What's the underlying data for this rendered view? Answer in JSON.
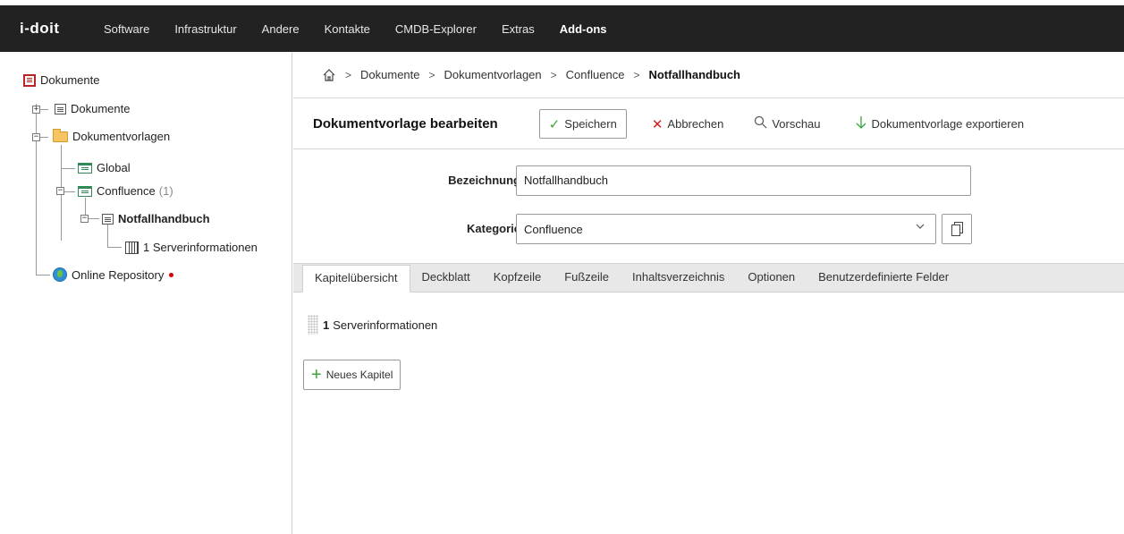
{
  "app": {
    "logo": "i-doit",
    "nav": [
      "Software",
      "Infrastruktur",
      "Andere",
      "Kontakte",
      "CMDB-Explorer",
      "Extras",
      "Add-ons"
    ],
    "nav_active": "Add-ons"
  },
  "tree": {
    "root": "Dokumente",
    "dokumente": "Dokumente",
    "vorlagen": "Dokumentvorlagen",
    "global": "Global",
    "confluence": "Confluence",
    "confluence_count": "(1)",
    "notfall": "Notfallhandbuch",
    "server": "1 Serverinformationen",
    "online_repo": "Online Repository"
  },
  "breadcrumb": [
    "Dokumente",
    "Dokumentvorlagen",
    "Confluence",
    "Notfallhandbuch"
  ],
  "toolbar": {
    "title": "Dokumentvorlage bearbeiten",
    "save_label": "Speichern",
    "cancel_label": "Abbrechen",
    "preview_label": "Vorschau",
    "export_label": "Dokumentvorlage exportieren"
  },
  "form": {
    "bezeichnung_label": "Bezeichnung",
    "bezeichnung_value": "Notfallhandbuch",
    "kategorie_label": "Kategorie",
    "kategorie_value": "Confluence"
  },
  "tabs": [
    "Kapitelübersicht",
    "Deckblatt",
    "Kopfzeile",
    "Fußzeile",
    "Inhaltsverzeichnis",
    "Optionen",
    "Benutzerdefinierte Felder"
  ],
  "active_tab": "Kapitelübersicht",
  "chapters": [
    {
      "num": "1",
      "title": "Serverinformationen"
    }
  ],
  "new_chapter_label": "Neues Kapitel",
  "colors": {
    "topbar": "#222222",
    "accent_green": "#3aa33a",
    "accent_red": "#d21e1e"
  }
}
